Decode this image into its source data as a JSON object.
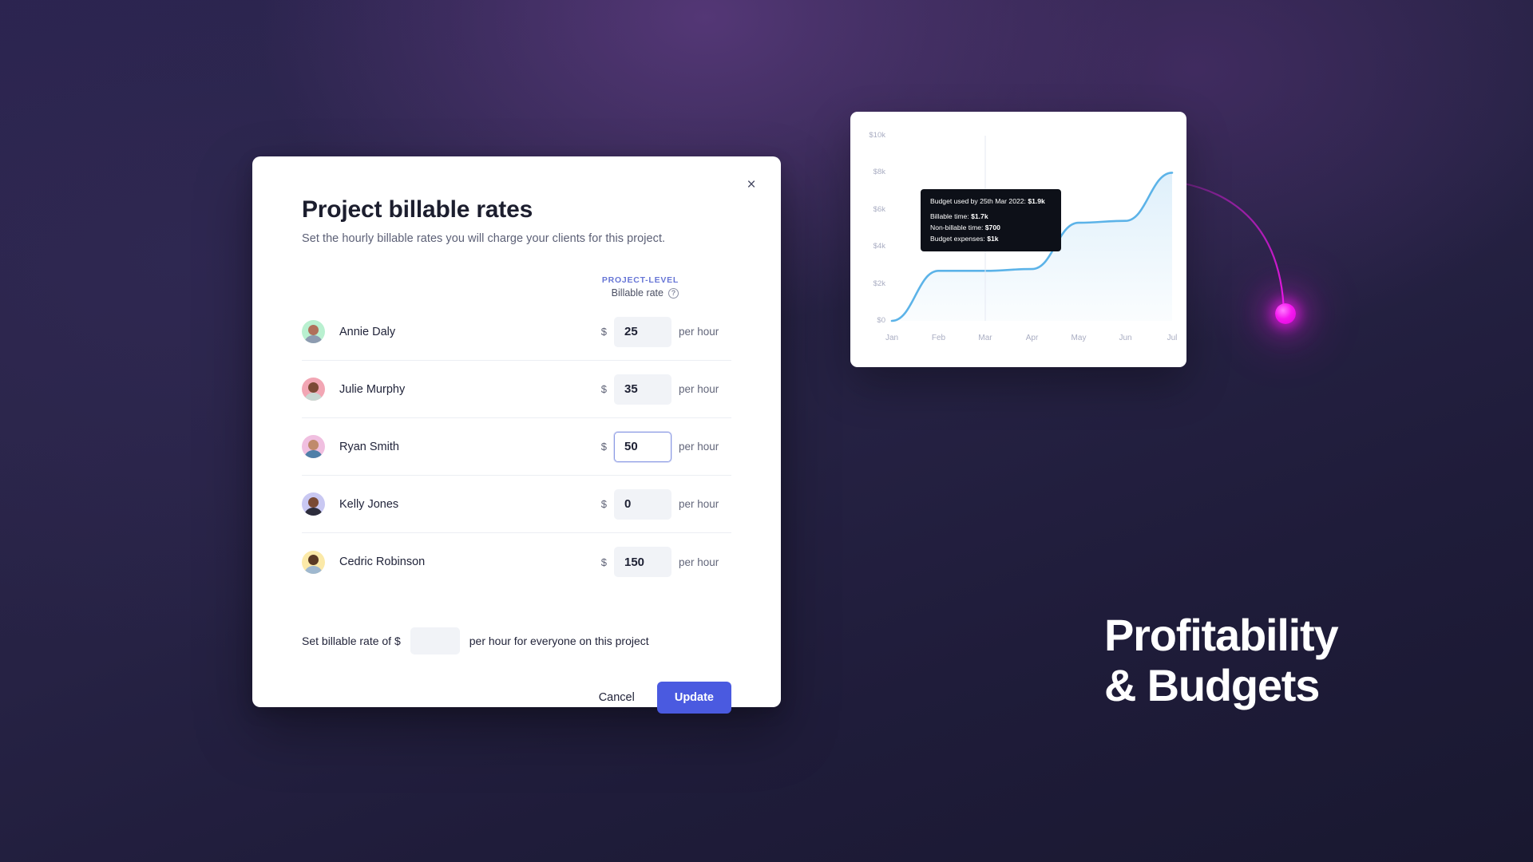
{
  "background": {
    "gradient_from": "#2b2350",
    "gradient_mid": "#43305e",
    "gradient_to": "#191830",
    "accent_dot_color": "#f618f0"
  },
  "modal": {
    "title": "Project billable rates",
    "subtitle": "Set the hourly billable rates you will charge your clients for this project.",
    "close_label": "×",
    "column_header": {
      "kicker": "PROJECT-LEVEL",
      "label": "Billable rate",
      "info_icon": "info-icon",
      "info_glyph": "?"
    },
    "rows": [
      {
        "name": "Annie Daly",
        "currency": "$",
        "rate": "25",
        "unit": "per hour",
        "focused": false,
        "avatar_bg": "#b9f0d0",
        "avatar_skin": "#b0705a",
        "avatar_body": "#8d9bb0"
      },
      {
        "name": "Julie Murphy",
        "currency": "$",
        "rate": "35",
        "unit": "per hour",
        "focused": false,
        "avatar_bg": "#f2a6b4",
        "avatar_skin": "#7c4a36",
        "avatar_body": "#c8d8d2"
      },
      {
        "name": "Ryan Smith",
        "currency": "$",
        "rate": "50",
        "unit": "per hour",
        "focused": true,
        "avatar_bg": "#f0bfe0",
        "avatar_skin": "#c08a6c",
        "avatar_body": "#4f7fa8"
      },
      {
        "name": "Kelly Jones",
        "currency": "$",
        "rate": "0",
        "unit": "per hour",
        "focused": false,
        "avatar_bg": "#c9c8f2",
        "avatar_skin": "#7a4a34",
        "avatar_body": "#2d2d3c"
      },
      {
        "name": "Cedric Robinson",
        "currency": "$",
        "rate": "150",
        "unit": "per hour",
        "focused": false,
        "avatar_bg": "#fbe9a8",
        "avatar_skin": "#5a3a24",
        "avatar_body": "#9fb8cf"
      }
    ],
    "global_rate": {
      "prefix": "Set billable rate of $",
      "value": "",
      "placeholder": "",
      "suffix": "per hour for everyone on this project"
    },
    "footer": {
      "cancel_label": "Cancel",
      "update_label": "Update",
      "update_color": "#4a5ae0"
    }
  },
  "chart_card": {
    "tooltip": {
      "headline_prefix": "Budget used by 25th Mar 2022:",
      "headline_value": "$1.9k",
      "lines": [
        {
          "label": "Billable time:",
          "value": "$1.7k"
        },
        {
          "label": "Non-billable time:",
          "value": "$700"
        },
        {
          "label": "Budget expenses:",
          "value": "$1k"
        }
      ]
    }
  },
  "chart_data": {
    "type": "area",
    "title": "",
    "xlabel": "",
    "ylabel": "",
    "line_color": "#5cb3e8",
    "fill_color": "#d9edfa",
    "grid": false,
    "categories": [
      "Jan",
      "Feb",
      "Mar",
      "Apr",
      "May",
      "Jun",
      "Jul"
    ],
    "ytick_labels": [
      "$0",
      "$2k",
      "$4k",
      "$6k",
      "$8k",
      "$10k"
    ],
    "ytick_values": [
      0,
      2000,
      4000,
      6000,
      8000,
      10000
    ],
    "ylim": [
      0,
      10000
    ],
    "series": [
      {
        "name": "Budget used",
        "values": [
          0,
          2700,
          2700,
          2800,
          5300,
          5400,
          8000
        ]
      }
    ],
    "points": [
      {
        "x": "Jan",
        "y": 0
      },
      {
        "x": "Feb",
        "y": 2700
      },
      {
        "x": "Mar",
        "y": 2700
      },
      {
        "x": "Apr",
        "y": 2800
      },
      {
        "x": "May",
        "y": 5300
      },
      {
        "x": "Jun",
        "y": 5400
      },
      {
        "x": "Jul",
        "y": 8000
      }
    ],
    "annotation": {
      "at_x": "Mar",
      "at_value": 1900,
      "text": "Budget used by 25th Mar 2022: $1.9k"
    }
  },
  "headline": {
    "line1": "Profitability",
    "line2": "& Budgets"
  }
}
